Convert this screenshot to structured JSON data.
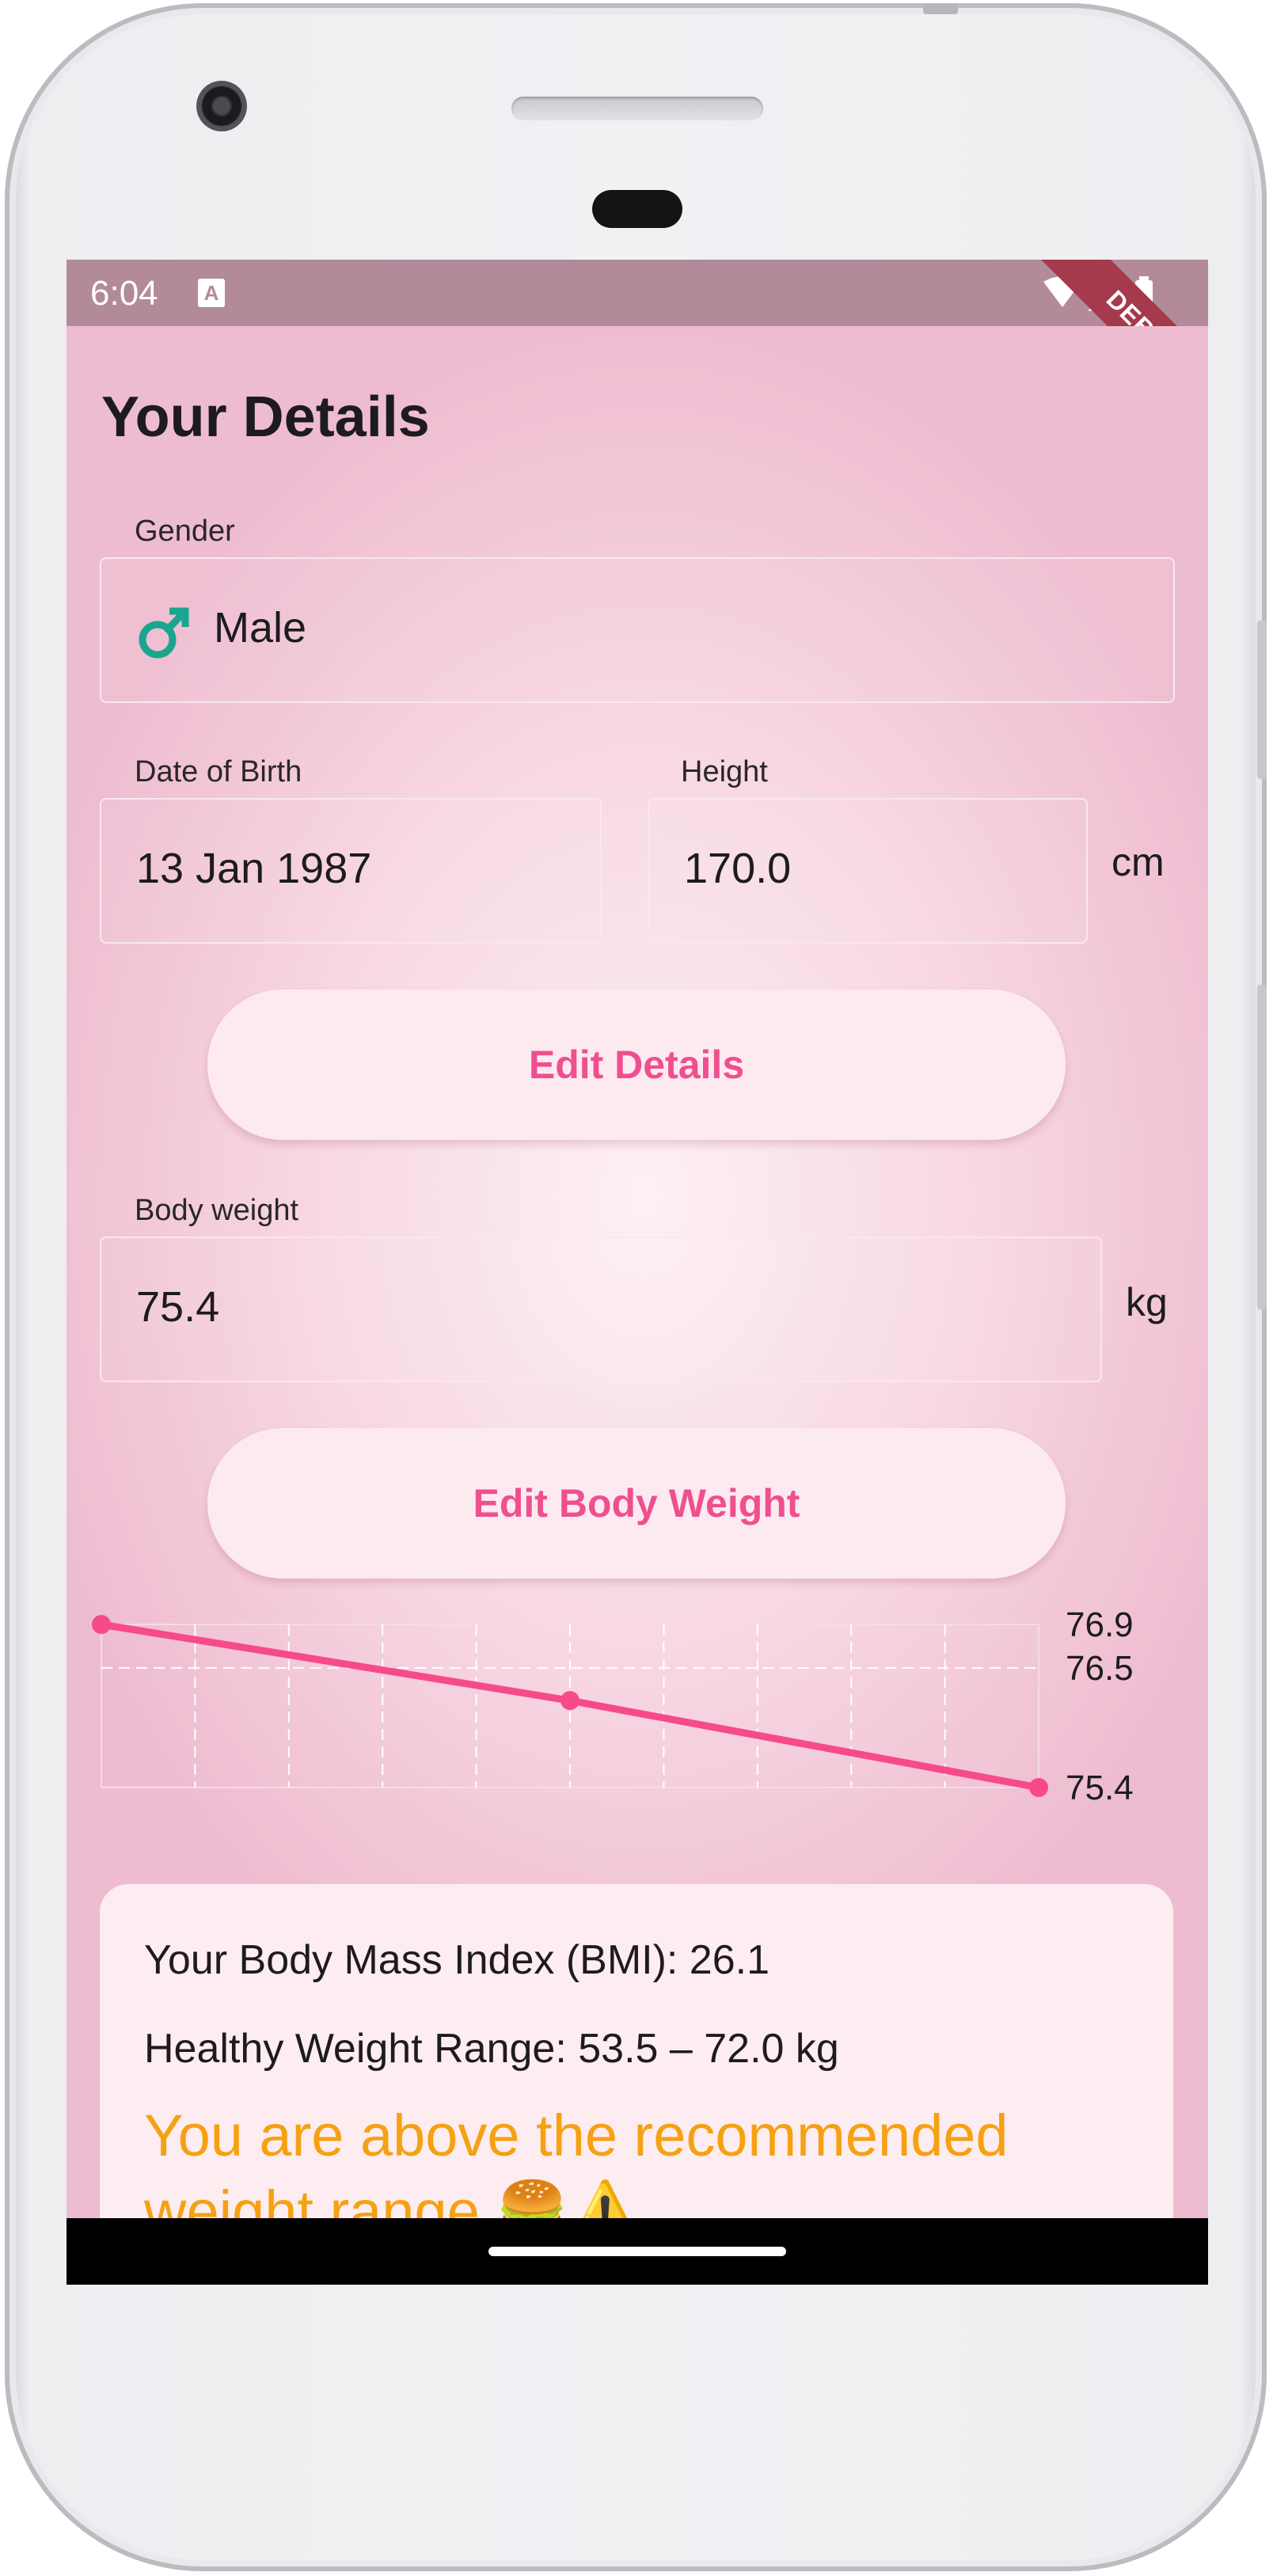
{
  "status": {
    "time": "6:04",
    "a_icon": "A",
    "debug": "DEBUG"
  },
  "page": {
    "title": "Your Details"
  },
  "gender": {
    "label": "Gender",
    "value": "Male",
    "icon": "male-symbol-icon"
  },
  "dob": {
    "label": "Date of Birth",
    "value": "13 Jan 1987"
  },
  "height": {
    "label": "Height",
    "value": "170.0",
    "unit": "cm"
  },
  "edit_details_label": "Edit Details",
  "body_weight": {
    "label": "Body weight",
    "value": "75.4",
    "unit": "kg"
  },
  "edit_weight_label": "Edit Body Weight",
  "chart_data": {
    "type": "line",
    "series": [
      {
        "values": [
          76.9,
          76.2,
          75.4
        ]
      }
    ],
    "y_labels": [
      "76.9",
      "76.5",
      "75.4"
    ],
    "reference_line": 76.5,
    "grid": true,
    "color": "#f74a8a"
  },
  "bmi": {
    "index_text": "Your Body Mass Index (BMI): 26.1",
    "range_text": "Healthy Weight Range: 53.5 – 72.0 kg",
    "warning_text": "You are above the recommended weight range 🍔⚠️"
  },
  "colors": {
    "accent": "#ef4f8f",
    "warning": "#f5a112"
  }
}
